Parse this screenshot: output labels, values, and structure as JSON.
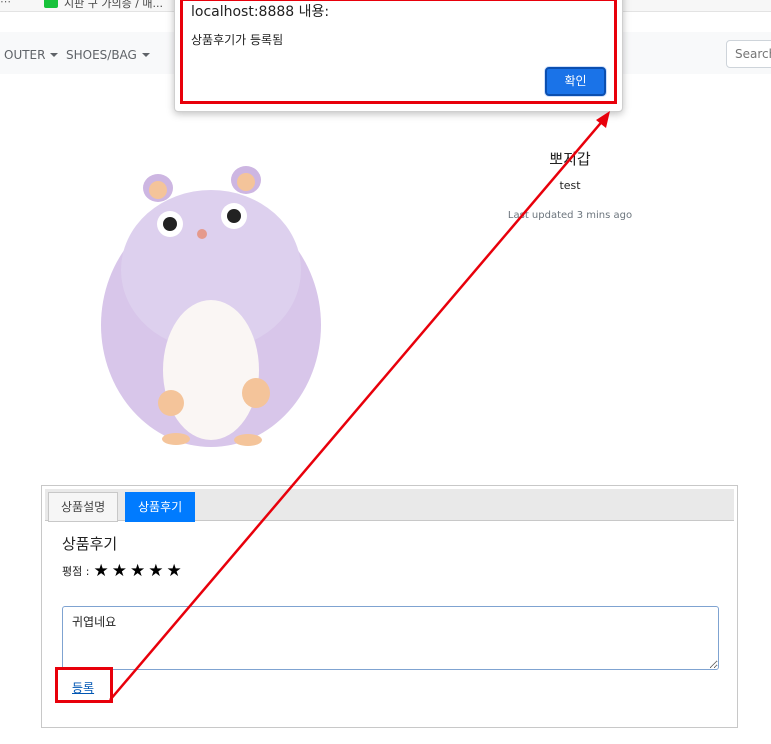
{
  "browser": {
    "dots": "⋯",
    "tab_text": "시판 구 가의증 / 매..."
  },
  "navbar": {
    "items": [
      {
        "label": "OUTER"
      },
      {
        "label": "SHOES/BAG"
      }
    ],
    "search_placeholder": "Search"
  },
  "product": {
    "name": "뽀지갑",
    "description": "test",
    "updated": "Last updated 3 mins ago"
  },
  "tabs": [
    {
      "label": "상품설명",
      "active": false
    },
    {
      "label": "상품후기",
      "active": true
    }
  ],
  "review": {
    "title": "상품후기",
    "rating_label": "평점 :",
    "stars": [
      "★",
      "★",
      "★",
      "★",
      "★"
    ],
    "text": "귀엽네요",
    "submit_label": "등록"
  },
  "alert": {
    "title": "localhost:8888 내용:",
    "message": "상품후기가 등록됨",
    "ok_label": "확인"
  },
  "colors": {
    "accent": "#007bff",
    "annotation": "#e8000b",
    "dialog_button": "#1a73e8"
  }
}
